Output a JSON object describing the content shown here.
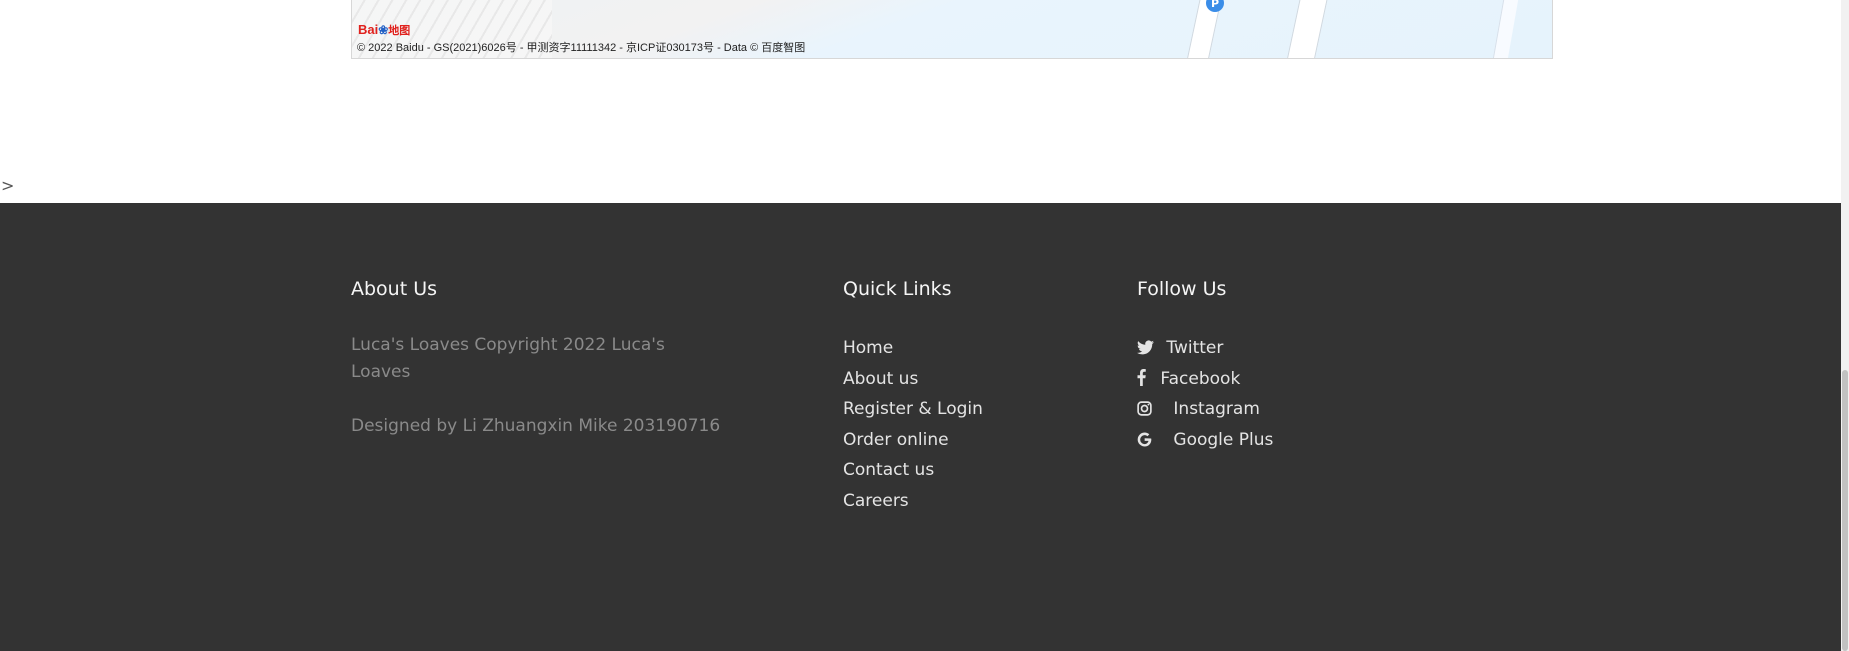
{
  "map": {
    "logo_latin": "Bai",
    "logo_cn": "地图",
    "pin_label": "P",
    "copyright": "© 2022 Baidu - GS(2021)6026号 - 甲测资字11111342 - 京ICP证030173号 - Data © 百度智图"
  },
  "stray_text": ">",
  "footer": {
    "about": {
      "heading": "About Us",
      "copyright": "Luca's Loaves Copyright 2022 Luca's Loaves",
      "designed_by": "Designed by Li Zhuangxin Mike 203190716"
    },
    "quick_links": {
      "heading": "Quick Links",
      "items": [
        {
          "label": "Home"
        },
        {
          "label": "About us"
        },
        {
          "label": "Register & Login"
        },
        {
          "label": "Order online"
        },
        {
          "label": "Contact us"
        },
        {
          "label": "Careers"
        }
      ]
    },
    "follow": {
      "heading": "Follow Us",
      "items": [
        {
          "label": "Twitter",
          "icon": "twitter-icon"
        },
        {
          "label": "Facebook",
          "icon": "facebook-icon"
        },
        {
          "label": "Instagram",
          "icon": "instagram-icon"
        },
        {
          "label": "Google Plus",
          "icon": "google-plus-icon"
        }
      ]
    }
  },
  "colors": {
    "footer_bg": "#333333",
    "heading": "#f5f5f5",
    "link": "#e4e4e4",
    "muted": "#8a8a8a"
  }
}
